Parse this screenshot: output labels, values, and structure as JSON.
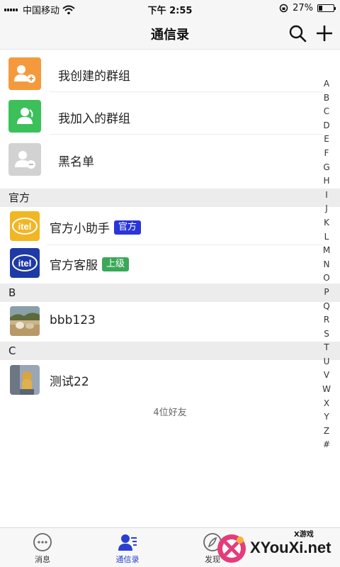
{
  "status_bar": {
    "carrier": "中国移动",
    "time": "下午 2:55",
    "battery": "27%",
    "battery_level": 0.27
  },
  "header": {
    "title": "通信录"
  },
  "groups": [
    {
      "label": "我创建的群组",
      "icon": "group-add-icon",
      "color": "#f59a3c"
    },
    {
      "label": "我加入的群组",
      "icon": "group-joined-icon",
      "color": "#3cc05a"
    },
    {
      "label": "黑名单",
      "icon": "blacklist-icon",
      "color": "#d2d2d2"
    }
  ],
  "sections": [
    {
      "title": "官方",
      "contacts": [
        {
          "name": "官方小助手",
          "badge": "官方",
          "badge_color": "#2a35d8",
          "avatar": "itel-yellow-logo"
        },
        {
          "name": "官方客服",
          "badge": "上级",
          "badge_color": "#3aa858",
          "avatar": "itel-blue-logo"
        }
      ]
    },
    {
      "title": "B",
      "contacts": [
        {
          "name": "bbb123",
          "avatar": "photo-avatar"
        }
      ]
    },
    {
      "title": "C",
      "contacts": [
        {
          "name": "测试22",
          "avatar": "photo-avatar"
        }
      ]
    }
  ],
  "friend_count": "4位好友",
  "index_letters": [
    "A",
    "B",
    "C",
    "D",
    "E",
    "F",
    "G",
    "H",
    "I",
    "J",
    "K",
    "L",
    "M",
    "N",
    "O",
    "P",
    "Q",
    "R",
    "S",
    "T",
    "U",
    "V",
    "W",
    "X",
    "Y",
    "Z",
    "#"
  ],
  "tabs": [
    {
      "label": "消息",
      "icon": "chat-bubble-icon"
    },
    {
      "label": "通信录",
      "icon": "contacts-icon",
      "active": true
    },
    {
      "label": "发现",
      "icon": "compass-icon"
    }
  ],
  "watermark": {
    "small": "X游戏",
    "text": "XYouXi.net"
  }
}
